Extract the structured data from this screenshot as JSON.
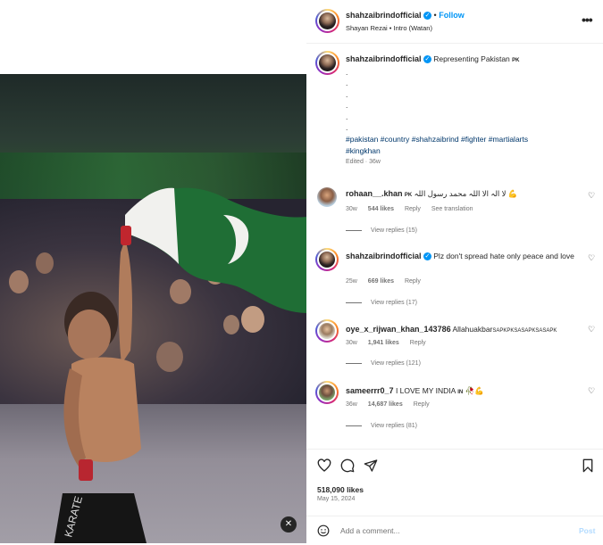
{
  "post": {
    "author": "shahzaibrindofficial",
    "follow_label": "Follow",
    "audio": "Shayan Rezai • Intro (Watan)",
    "caption": {
      "author": "shahzaibrindofficial",
      "text": "Representing Pakistan",
      "flag": "PK",
      "dots": [
        ".",
        ".",
        ".",
        ".",
        ".",
        "."
      ],
      "hashtags_line1": "#pakistan #country #shahzaibrind #fighter #martialarts",
      "hashtags_line2": "#kingkhan",
      "edited": "Edited · 36w"
    },
    "likes": "518,090 likes",
    "date": "May 15, 2024",
    "add_comment_placeholder": "Add a comment...",
    "post_label": "Post"
  },
  "comments": [
    {
      "user": "rohaan__.khan",
      "flag": "PK",
      "text": "لا الہ الا اللہ محمد رسول اللہ 💪",
      "age": "30w",
      "likes": "544 likes",
      "reply": "Reply",
      "translate": "See translation",
      "view_replies": "View replies (15)"
    },
    {
      "user": "shahzaibrindofficial",
      "text": "Plz don't spread hate only peace and love",
      "age": "25w",
      "likes": "669 likes",
      "reply": "Reply",
      "view_replies": "View replies (17)"
    },
    {
      "user": "oye_x_rijwan_khan_143786",
      "text": "Allahuakbar",
      "suffix": "SAPKPKSASAPKSASAPK",
      "age": "30w",
      "likes": "1,941 likes",
      "reply": "Reply",
      "view_replies": "View replies (121)"
    },
    {
      "user": "sameerrr0_7",
      "text": "I LOVE MY INDIA",
      "flag": "IN",
      "emoji": "🥀💪",
      "age": "36w",
      "likes": "14,687 likes",
      "reply": "Reply",
      "view_replies": "View replies (81)"
    }
  ],
  "icons": {
    "verified": "verified-badge-icon",
    "more": "more-options-icon",
    "heart": "heart-icon",
    "comment": "comment-icon",
    "share": "share-icon",
    "save": "bookmark-icon",
    "emoji": "emoji-icon",
    "mute": "muted-audio-icon"
  },
  "colors": {
    "link": "#0095f6",
    "hashtag": "#00376b",
    "muted": "#737373"
  }
}
